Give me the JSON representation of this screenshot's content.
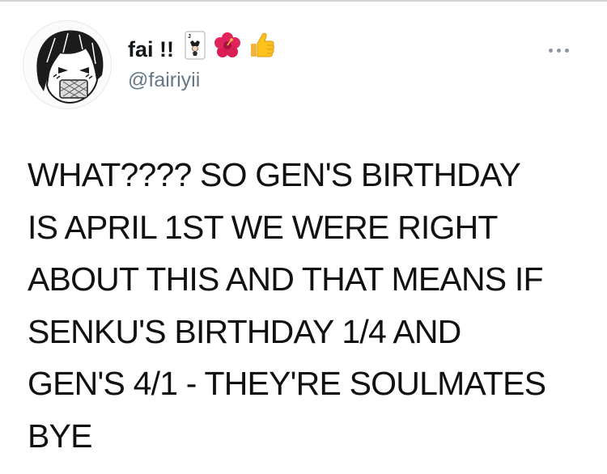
{
  "tweet": {
    "author": {
      "display_name": "fai !!",
      "handle": "@fairiyii",
      "name_emojis": [
        "joker-card-icon",
        "hibiscus-icon",
        "thumbs-up-icon"
      ]
    },
    "text_lines": [
      "WHAT????  SO GEN'S BIRTHDAY",
      "IS APRIL 1ST WE WERE RIGHT",
      "ABOUT THIS AND THAT MEANS IF",
      "SENKU'S BIRTHDAY 1/4 AND",
      "GEN'S 4/1 - THEY'RE SOULMATES",
      "BYE"
    ]
  },
  "colors": {
    "name": "#14171a",
    "handle": "#657786",
    "text": "#111111",
    "more_icon": "#8a97a2"
  }
}
